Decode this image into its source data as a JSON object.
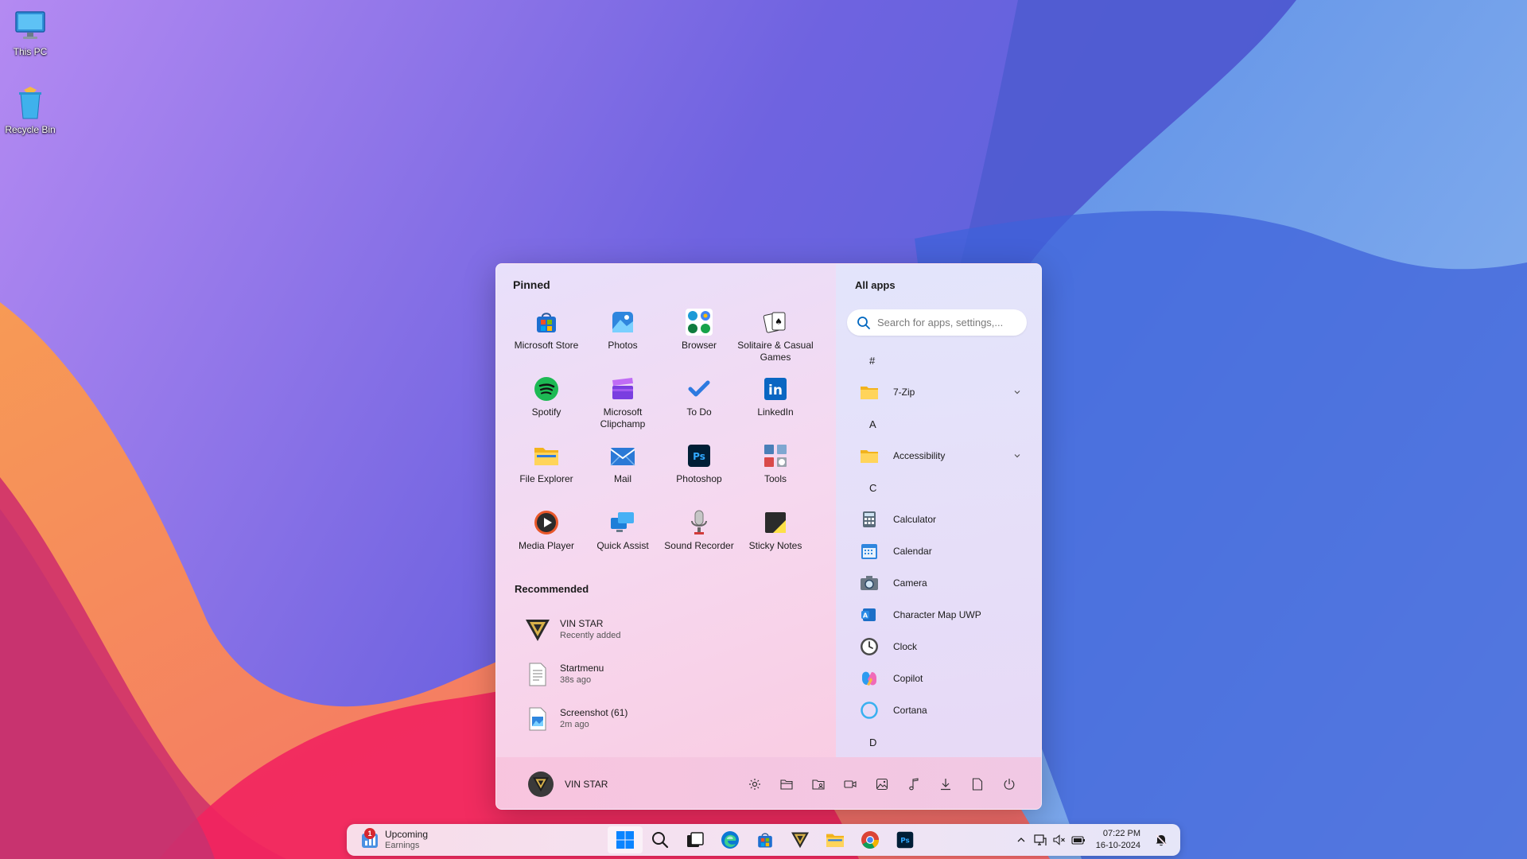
{
  "desktop": {
    "icons": [
      {
        "label": "This PC",
        "icon": "monitor-icon"
      },
      {
        "label": "Recycle Bin",
        "icon": "recycle-bin-icon"
      }
    ]
  },
  "start_menu": {
    "pinned_title": "Pinned",
    "pinned": [
      {
        "label": "Microsoft Store",
        "icon": "store-icon"
      },
      {
        "label": "Photos",
        "icon": "photos-icon"
      },
      {
        "label": "Browser",
        "icon": "browser-icon"
      },
      {
        "label": "Solitaire & Casual Games",
        "icon": "solitaire-icon"
      },
      {
        "label": "Spotify",
        "icon": "spotify-icon"
      },
      {
        "label": "Microsoft Clipchamp",
        "icon": "clipchamp-icon"
      },
      {
        "label": "To Do",
        "icon": "todo-icon"
      },
      {
        "label": "LinkedIn",
        "icon": "linkedin-icon"
      },
      {
        "label": "File Explorer",
        "icon": "folder-icon"
      },
      {
        "label": "Mail",
        "icon": "mail-icon"
      },
      {
        "label": "Photoshop",
        "icon": "photoshop-icon"
      },
      {
        "label": "Tools",
        "icon": "tools-icon"
      },
      {
        "label": "Media Player",
        "icon": "media-player-icon"
      },
      {
        "label": "Quick Assist",
        "icon": "quick-assist-icon"
      },
      {
        "label": "Sound Recorder",
        "icon": "microphone-icon"
      },
      {
        "label": "Sticky Notes",
        "icon": "sticky-notes-icon"
      }
    ],
    "recommended_title": "Recommended",
    "recommended": [
      {
        "name": "VIN STAR",
        "sub": "Recently added",
        "icon": "vinstar-logo-icon"
      },
      {
        "name": "Startmenu",
        "sub": "38s ago",
        "icon": "text-document-icon"
      },
      {
        "name": "Screenshot (61)",
        "sub": "2m ago",
        "icon": "image-file-icon"
      }
    ],
    "all_apps_title": "All apps",
    "search_placeholder": "Search for apps, settings,...",
    "all_apps": [
      {
        "type": "letter",
        "label": "#"
      },
      {
        "type": "app",
        "label": "7-Zip",
        "icon": "folder-icon",
        "expandable": true
      },
      {
        "type": "letter",
        "label": "A"
      },
      {
        "type": "app",
        "label": "Accessibility",
        "icon": "folder-icon",
        "expandable": true
      },
      {
        "type": "letter",
        "label": "C"
      },
      {
        "type": "app",
        "label": "Calculator",
        "icon": "calculator-icon"
      },
      {
        "type": "app",
        "label": "Calendar",
        "icon": "calendar-icon"
      },
      {
        "type": "app",
        "label": "Camera",
        "icon": "camera-icon"
      },
      {
        "type": "app",
        "label": "Character Map UWP",
        "icon": "character-map-icon"
      },
      {
        "type": "app",
        "label": "Clock",
        "icon": "clock-icon"
      },
      {
        "type": "app",
        "label": "Copilot",
        "icon": "copilot-icon"
      },
      {
        "type": "app",
        "label": "Cortana",
        "icon": "cortana-icon"
      },
      {
        "type": "letter",
        "label": "D"
      }
    ],
    "user_name": "VIN STAR",
    "quick_icons": [
      "settings-icon",
      "documents-icon",
      "personal-folder-icon",
      "videos-icon",
      "pictures-icon",
      "music-icon",
      "downloads-icon",
      "file-icon",
      "power-icon"
    ]
  },
  "taskbar": {
    "widget_badge": "1",
    "widget_title": "Upcoming",
    "widget_subtitle": "Earnings",
    "apps": [
      "start-icon",
      "search-icon",
      "task-view-icon",
      "edge-icon",
      "store-icon",
      "vinstar-logo-icon",
      "folder-icon",
      "chrome-icon",
      "photoshop-icon"
    ],
    "tray": [
      "chevron-up-icon",
      "network-icon",
      "volume-muted-icon",
      "battery-icon"
    ],
    "time": "07:22 PM",
    "date": "16-10-2024",
    "notification_icon": "notification-bell-icon"
  },
  "colors": {
    "accent": "#0067c0",
    "badge": "#d6262f"
  }
}
